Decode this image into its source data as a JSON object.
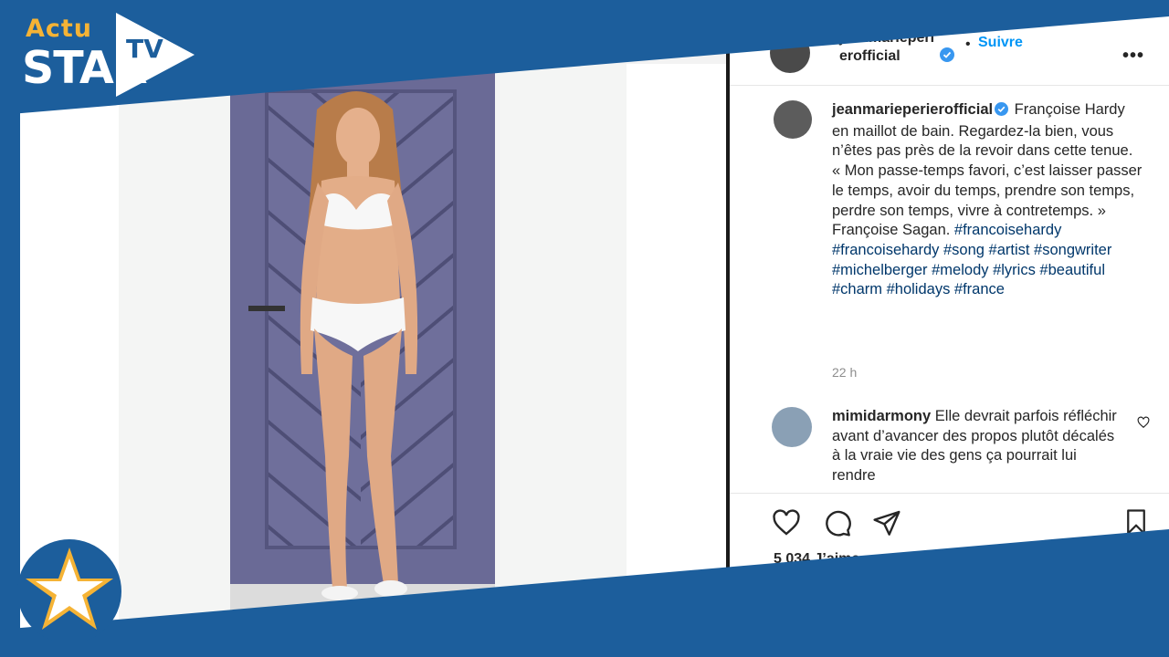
{
  "brand": {
    "actu": "Actu",
    "star": "STAR",
    "tv": "TV",
    "blue": "#1c5e9c",
    "gold": "#f5b335"
  },
  "post": {
    "header": {
      "username_part1": "jeanmarieperierofficial",
      "follow_label": "Suivre",
      "dot": "•",
      "more_icon": "more-options-icon"
    },
    "caption": {
      "username": "jeanmarieperierofficial",
      "text": "Françoise Hardy en maillot de bain. Regardez-la bien, vous n’êtes pas près de la revoir dans cette tenue. « Mon passe-temps favori, c’est laisser passer le temps, avoir du temps, prendre son temps, perdre son temps, vivre à contretemps. » Françoise Sagan.",
      "hashtags": "#francoisehardy #francoisehardy #song #artist #songwriter #michelberger #melody #lyrics #beautiful #charm #holidays #france"
    },
    "time": "22 h",
    "comment": {
      "username": "mimidarmony",
      "text": "Elle devrait parfois réfléchir avant d’avancer des propos plutôt décalés à la vraie vie des gens ça pourrait lui rendre"
    },
    "likes": "5 034 J’aime",
    "actions": [
      "heart-icon",
      "comment-icon",
      "share-icon",
      "bookmark-icon"
    ]
  }
}
